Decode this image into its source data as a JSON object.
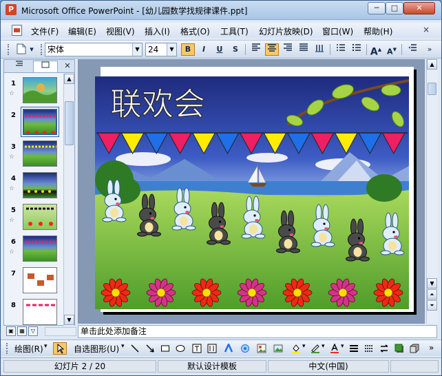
{
  "window": {
    "title": "Microsoft Office PowerPoint - [幼儿园数学找规律课件.ppt]",
    "app_icon_letter": "P",
    "controls": {
      "minimize": "─",
      "maximize": "□",
      "close": "✕"
    }
  },
  "menu": {
    "items": [
      "文件(F)",
      "编辑(E)",
      "视图(V)",
      "插入(I)",
      "格式(O)",
      "工具(T)",
      "幻灯片放映(D)",
      "窗口(W)",
      "帮助(H)"
    ],
    "end_glyph": "×"
  },
  "format_toolbar": {
    "font_name": "宋体",
    "font_size": "24",
    "bold": "B",
    "italic": "I",
    "underline": "U",
    "shadow": "S",
    "grow_font": "A",
    "shrink_font": "A"
  },
  "slides_panel": {
    "tab_close": "✕",
    "selected_index": 2,
    "thumbnails": [
      {
        "number": "1",
        "star": "☆"
      },
      {
        "number": "2",
        "star": ""
      },
      {
        "number": "3",
        "star": "☆"
      },
      {
        "number": "4",
        "star": "☆"
      },
      {
        "number": "5",
        "star": "☆"
      },
      {
        "number": "6",
        "star": "☆"
      },
      {
        "number": "7",
        "star": ""
      },
      {
        "number": "8",
        "star": ""
      }
    ]
  },
  "slide": {
    "title": "联欢会",
    "pennant_colors": [
      "#ee1f62",
      "#ffec00",
      "#1e6fe8",
      "#ee1f62",
      "#ffec00",
      "#1e6fe8",
      "#ee1f62",
      "#ffec00",
      "#1e6fe8",
      "#ee1f62",
      "#ffec00",
      "#1e6fe8",
      "#ee1f62"
    ],
    "bunny_sequence": [
      "white",
      "gray",
      "white",
      "gray",
      "white",
      "gray",
      "white",
      "gray",
      "white"
    ],
    "flower_sequence": [
      "red",
      "magenta",
      "red",
      "magenta",
      "red",
      "magenta",
      "red"
    ],
    "colors": {
      "flower_red": "#ee2a14",
      "flower_magenta": "#d2338f",
      "flower_center": "#ffdd00",
      "bunny_white": "#dfeefb",
      "bunny_gray": "#4a4a4a",
      "sky_top": "#1e2b7e",
      "grass": "#6cbc3c"
    }
  },
  "notes_placeholder": "单击此处添加备注",
  "draw_toolbar": {
    "draw_label": "绘图(R)",
    "autoshapes_label": "自选图形(U)"
  },
  "status": {
    "slide_position": "幻灯片 2 / 20",
    "design_template": "默认设计模板",
    "language": "中文(中国)"
  }
}
